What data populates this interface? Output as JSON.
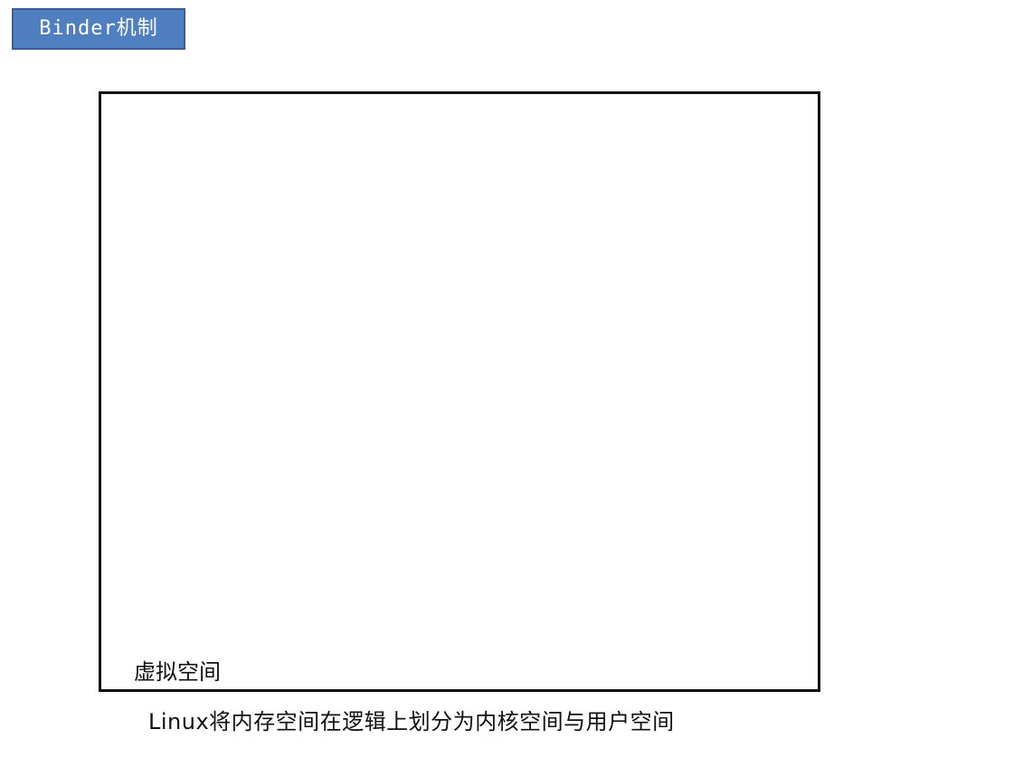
{
  "title": "Binder机制",
  "diagram": {
    "box_label": "虚拟空间"
  },
  "caption": "Linux将内存空间在逻辑上划分为内核空间与用户空间",
  "colors": {
    "title_bg": "#4f7fc1",
    "title_border": "#3a5f93",
    "title_text": "#ffffff",
    "box_border": "#111111"
  }
}
